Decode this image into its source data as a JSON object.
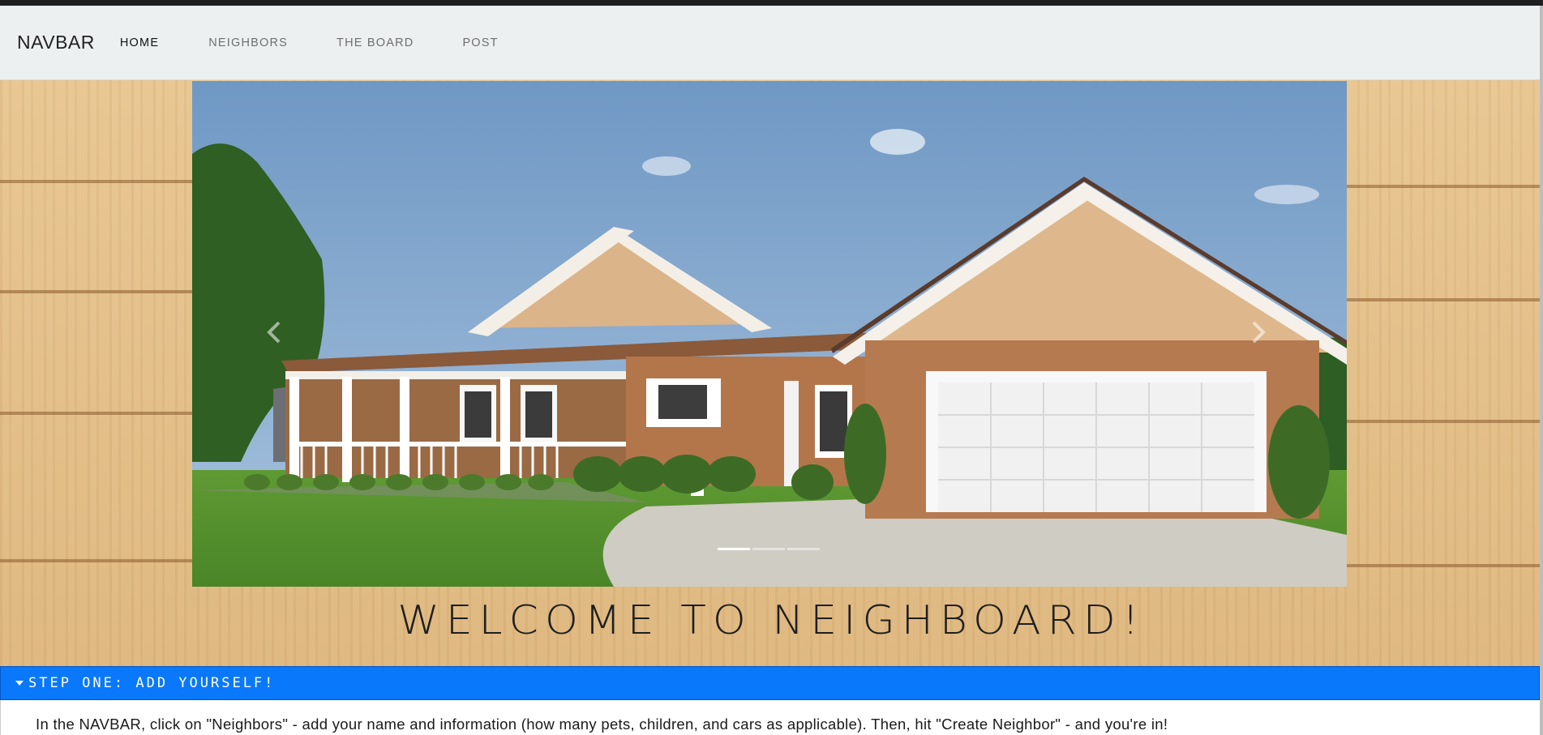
{
  "navbar": {
    "brand": "NAVBAR",
    "links": [
      {
        "label": "HOME",
        "active": true
      },
      {
        "label": "NEIGHBORS",
        "active": false
      },
      {
        "label": "THE BOARD",
        "active": false
      },
      {
        "label": "POST",
        "active": false
      }
    ]
  },
  "carousel": {
    "slide_count": 3,
    "active_index": 0,
    "prev_icon": "chevron-left-icon",
    "next_icon": "chevron-right-icon"
  },
  "welcome": {
    "heading": "WELCOME TO NEIGHBOARD!"
  },
  "accordion": {
    "title": "STEP ONE: ADD YOURSELF!",
    "expanded": true,
    "body": "In the NAVBAR, click on \"Neighbors\" - add your name and information (how many pets, children, and cars as applicable). Then, hit \"Create Neighbor\" - and you're in!"
  },
  "colors": {
    "navbar_bg": "#ecf0f1",
    "accordion_header_bg": "#0a78fb",
    "wood": "#e6c28e"
  }
}
